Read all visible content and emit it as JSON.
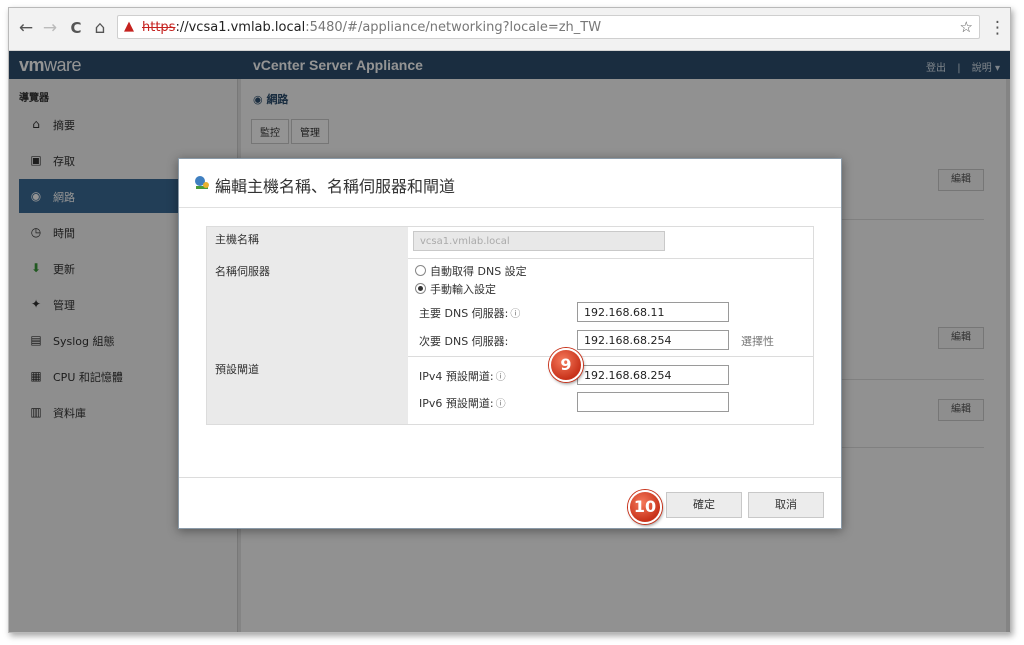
{
  "browser": {
    "back": "←",
    "forward": "→",
    "reload": "C",
    "home": "⌂",
    "url_scheme": "https",
    "url_host": "://vcsa1.vmlab.local",
    "url_rest": ":5480/#/appliance/networking?locale=zh_TW",
    "star": "☆",
    "menu": "⋮"
  },
  "app": {
    "logo_bold": "vm",
    "logo_light": "ware",
    "title": "vCenter Server Appliance",
    "logout": "登出",
    "sep": "|",
    "help": "說明 ▾"
  },
  "sidebar": {
    "heading": "導覽器",
    "items": [
      {
        "label": "摘要",
        "icon": "home-icon"
      },
      {
        "label": "存取",
        "icon": "access-icon"
      },
      {
        "label": "網路",
        "icon": "network-icon"
      },
      {
        "label": "時間",
        "icon": "clock-icon"
      },
      {
        "label": "更新",
        "icon": "update-icon"
      },
      {
        "label": "管理",
        "icon": "admin-icon"
      },
      {
        "label": "Syslog 組態",
        "icon": "syslog-icon"
      },
      {
        "label": "CPU 和記憶體",
        "icon": "cpu-icon"
      },
      {
        "label": "資料庫",
        "icon": "database-icon"
      }
    ]
  },
  "content": {
    "crumb": "網路",
    "tab_monitor": "監控",
    "tab_manage": "管理",
    "edit": "編輯"
  },
  "modal": {
    "title": "編輯主機名稱、名稱伺服器和閘道",
    "hostname_label": "主機名稱",
    "hostname_value": "vcsa1.vmlab.local",
    "nameserver_label": "名稱伺服器",
    "radio_auto": "自動取得 DNS 設定",
    "radio_manual": "手動輸入設定",
    "primary_dns_label": "主要 DNS 伺服器:",
    "primary_dns_value": "192.168.68.11",
    "secondary_dns_label": "次要 DNS 伺服器:",
    "secondary_dns_value": "192.168.68.254",
    "optional": "選擇性",
    "gateway_label": "預設閘道",
    "ipv4_gw_label": "IPv4 預設閘道:",
    "ipv4_gw_value": "192.168.68.254",
    "ipv6_gw_label": "IPv6 預設閘道:",
    "ipv6_gw_value": "",
    "info": "ⓘ",
    "ok": "確定",
    "cancel": "取消"
  },
  "badges": {
    "step9": "9",
    "step10": "10"
  }
}
